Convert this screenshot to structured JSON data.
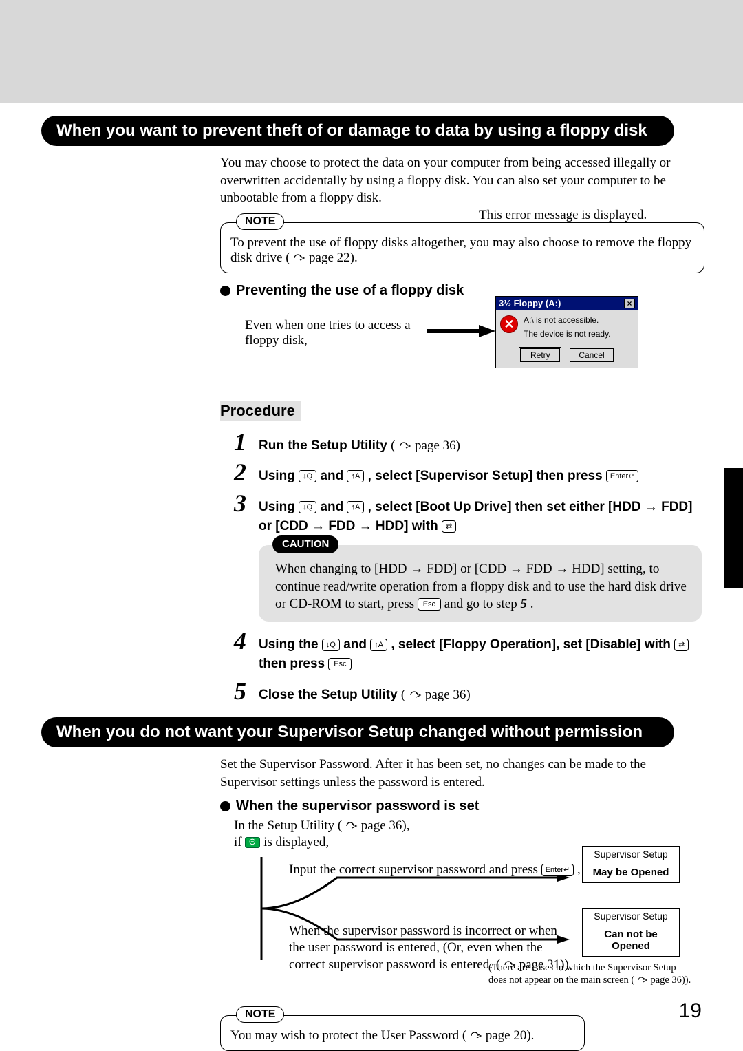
{
  "page_number": "19",
  "section1": {
    "title": "When you want to prevent theft of or damage to data by using a floppy disk",
    "intro": "You may choose to protect the data on your computer from being accessed illegally or overwritten accidentally by using a floppy disk.  You can also set your computer to be unbootable from a floppy disk.",
    "note_label": "NOTE",
    "note_text_a": "To prevent the use of floppy disks altogether, you may also choose to remove the floppy disk drive (",
    "note_text_b": "page 22).",
    "subhead": "Preventing the use of a floppy disk",
    "even_text": "Even when one tries to access a floppy disk,",
    "err_caption": "This error message is displayed.",
    "dialog": {
      "title": "3½ Floppy (A:)",
      "line1": "A:\\ is not accessible.",
      "line2": "The device is not ready.",
      "retry": "Retry",
      "cancel": "Cancel",
      "retry_u": "R",
      "close": "×"
    },
    "procedure_label": "Procedure",
    "steps": {
      "s1a": "Run the Setup Utility",
      "s1b": " page 36)",
      "s2a": "Using ",
      "s2b": " and ",
      "s2c": ", select [Supervisor Setup] then press ",
      "s3a": "Using ",
      "s3b": " and ",
      "s3c": ", select [Boot Up Drive] then set either [HDD → FDD] or [CDD → FDD → HDD] with ",
      "s4a": "Using the ",
      "s4b": " and ",
      "s4c": ", select [Floppy Operation], set [Disable] with ",
      "s4d": " then press ",
      "s5a": "Close the Setup Utility",
      "s5b": " page 36)"
    },
    "caution_label": "CAUTION",
    "caution_a": "When changing to [HDD  →  FDD] or [CDD  →  FDD  →  HDD] setting, to continue read/write operation from a floppy disk and to use the hard disk drive or CD-ROM to start, press ",
    "caution_b": " and go to step ",
    "caution_step": "5",
    "caution_c": ".",
    "keys": {
      "down": "↓Q",
      "up": "↑A",
      "enter": "Enter↵",
      "toggle": "⇄",
      "esc": "Esc"
    }
  },
  "section2": {
    "title": "When you do not want your Supervisor Setup changed without permission",
    "intro": "Set the Supervisor Password.  After it has been set, no changes can be made to the Supervisor settings unless the password is entered.",
    "subhead": "When the supervisor password is set",
    "line1a": "In the Setup Utility  (",
    "line1b": "page 36),",
    "line2a": "if ",
    "line2b": " is displayed,",
    "flow_top": "Input the correct supervisor password and press ",
    "flow_top_end": " ,",
    "flow_bottom_a": "When the supervisor password is incorrect or when the user password is entered, (Or, even when the correct supervisor password is entered. (",
    "flow_bottom_b": "page 31))",
    "box_title": "Supervisor Setup",
    "box1_body": "May be Opened",
    "box2_body": "Can not be Opened",
    "footnote_a": "(There are cases in which the Supervisor Setup does not appear on the main screen (",
    "footnote_b": "page 36)).",
    "note_label": "NOTE",
    "note_text_a": "You may wish to protect the User Password (",
    "note_text_b": "page 20)."
  }
}
